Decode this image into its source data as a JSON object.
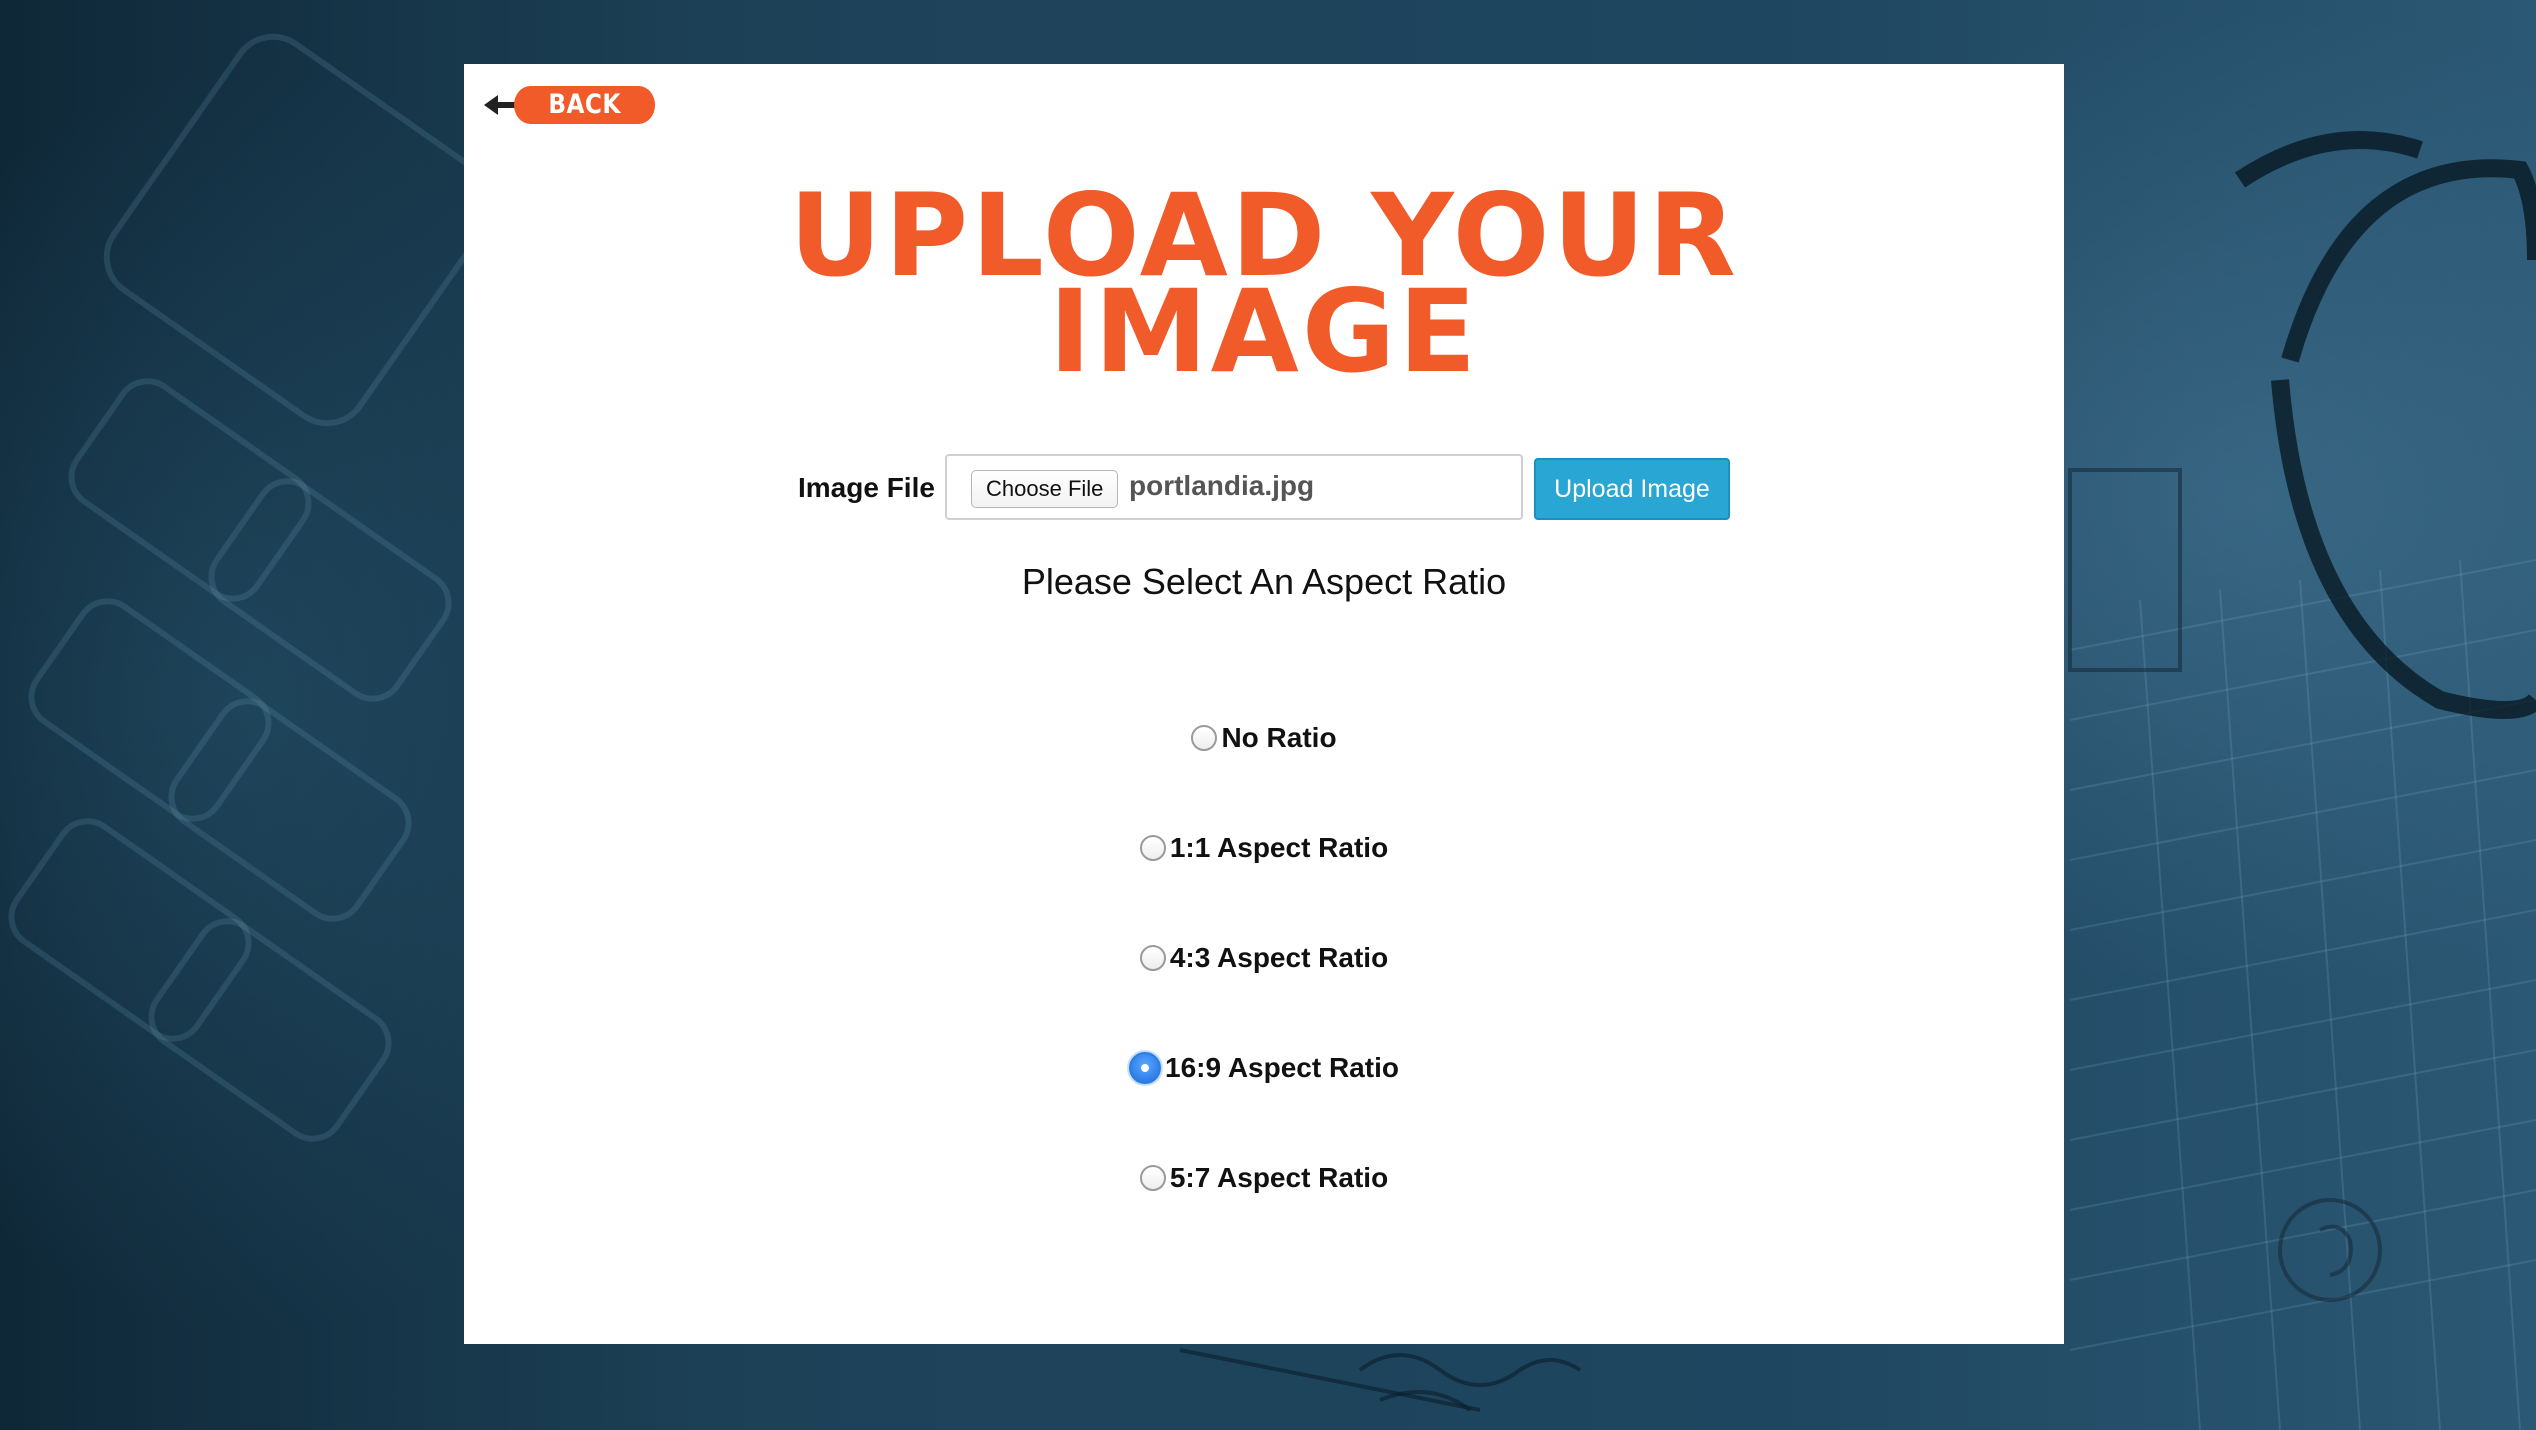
{
  "page": {
    "title_line1": "UPLOAD YOUR",
    "title_line2": "IMAGE"
  },
  "nav": {
    "back_label": "BACK"
  },
  "upload": {
    "label": "Image File",
    "choose_label": "Choose File",
    "file_name": "portlandia.jpg",
    "upload_label": "Upload Image"
  },
  "aspect": {
    "prompt": "Please Select An Aspect Ratio",
    "options": [
      {
        "label": "No Ratio",
        "checked": false
      },
      {
        "label": "1:1 Aspect Ratio",
        "checked": false
      },
      {
        "label": "4:3 Aspect Ratio",
        "checked": false
      },
      {
        "label": "16:9 Aspect Ratio",
        "checked": true
      },
      {
        "label": "5:7 Aspect Ratio",
        "checked": false
      }
    ]
  },
  "colors": {
    "accent": "#f15a29",
    "upload_button": "#2aa6d5",
    "background": "#19384b",
    "card": "#ffffff",
    "radio_checked": "#2b7fe0"
  },
  "icons": {
    "back": "back-arrow-icon"
  }
}
